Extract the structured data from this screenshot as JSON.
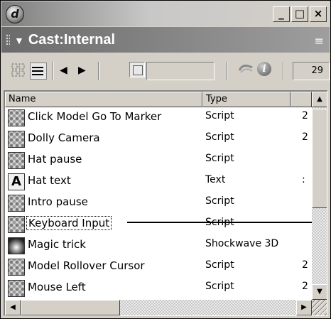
{
  "window": {
    "app_icon_glyph": "d",
    "minimize_glyph": "_",
    "maximize_glyph": "□",
    "close_glyph": "×"
  },
  "panel": {
    "title": "Cast:Internal",
    "collapse_arrow": "▼",
    "options_icon": "≡"
  },
  "toolbar": {
    "prev_glyph": "◀",
    "next_glyph": "▶",
    "member_name_value": "",
    "member_number": "29"
  },
  "columns": {
    "name": "Name",
    "type": "Type",
    "sort_glyph": "▲"
  },
  "rows": [
    {
      "icon": "script-icon",
      "name": "Click Model Go To Marker",
      "type": "Script",
      "extra": "2"
    },
    {
      "icon": "script-icon",
      "name": "Dolly Camera",
      "type": "Script",
      "extra": "2"
    },
    {
      "icon": "script-icon",
      "name": "Hat pause",
      "type": "Script",
      "extra": ""
    },
    {
      "icon": "text-icon",
      "name": "Hat text",
      "type": "Text",
      "extra": ":"
    },
    {
      "icon": "script-icon",
      "name": "Intro pause",
      "type": "Script",
      "extra": ""
    },
    {
      "icon": "script-icon",
      "name": "Keyboard Input",
      "type": "Script",
      "extra": ""
    },
    {
      "icon": "shockwave3d-icon",
      "name": "Magic trick",
      "type": "Shockwave 3D",
      "extra": ""
    },
    {
      "icon": "script-icon",
      "name": "Model Rollover Cursor",
      "type": "Script",
      "extra": "2"
    },
    {
      "icon": "script-icon",
      "name": "Mouse Left",
      "type": "Script",
      "extra": "2"
    }
  ],
  "scroll": {
    "up_glyph": "▲",
    "down_glyph": "▼",
    "left_glyph": "◀",
    "right_glyph": "▶"
  }
}
